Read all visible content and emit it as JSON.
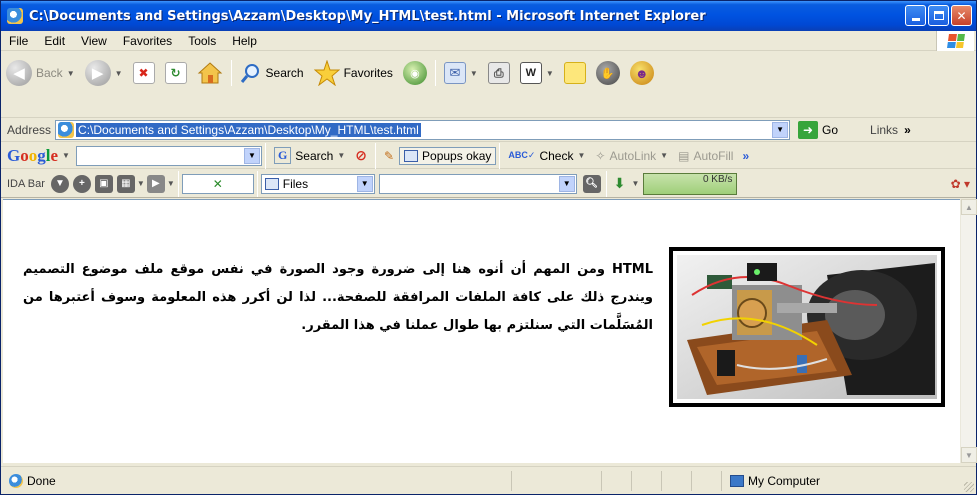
{
  "window": {
    "title": "C:\\Documents and Settings\\Azzam\\Desktop\\My_HTML\\test.html - Microsoft Internet Explorer"
  },
  "menu": [
    "File",
    "Edit",
    "View",
    "Favorites",
    "Tools",
    "Help"
  ],
  "toolbar": {
    "back_label": "Back",
    "search_label": "Search",
    "favorites_label": "Favorites"
  },
  "address": {
    "label": "Address",
    "url": "C:\\Documents and Settings\\Azzam\\Desktop\\My_HTML\\test.html",
    "go_label": "Go",
    "links_label": "Links",
    "more": "»"
  },
  "google_bar": {
    "logo": "Google",
    "search_label": "Search",
    "popups_label": "Popups okay",
    "check_label": "Check",
    "autolink_label": "AutoLink",
    "autofill_label": "AutoFill",
    "more": "»"
  },
  "ida_bar": {
    "label": "IDA Bar",
    "files_label": "Files",
    "speed_label": "0 KB/s"
  },
  "content": {
    "paragraph": "HTML ومن المهم أن أنوه هنا إلى ضرورة وجود الصورة في نفس موقع ملف موضوع التصميم ويندرج ذلك على كافة الملفات المرافقة للصفحة... لذا لن أكرر هذه المعلومة وسوف أعتبرها من المُسَلَّمات التي سنلتزم بها طوال عملنا في هذا المقرر."
  },
  "status": {
    "text": "Done",
    "zone": "My Computer"
  }
}
